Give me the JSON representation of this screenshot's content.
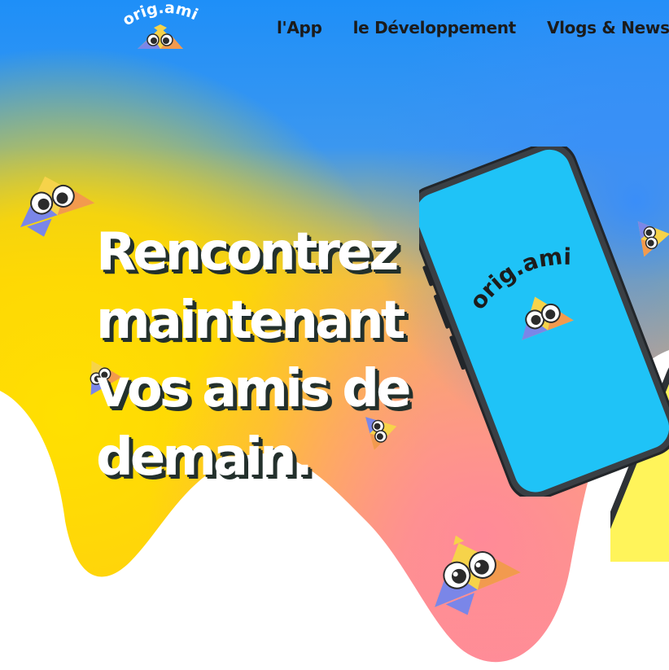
{
  "nav": {
    "brand": "orig.ami",
    "links": [
      "l'App",
      "le Développement",
      "Vlogs & News"
    ]
  },
  "hero": {
    "title": "Rencontrez maintenant vos amis de demain."
  },
  "phone": {
    "screen_brand": "orig.ami"
  },
  "colors": {
    "sky_blue": "#1e90ff",
    "yellow": "#ffd900",
    "orange": "#ffb347",
    "pink": "#ff8fa3",
    "phone_screen_blue": "#1fc3f7",
    "phone_screen_yellow": "#fff45a",
    "title_shadow": "#23302c"
  },
  "icons": {
    "mascot": "origami-owl-icon"
  }
}
